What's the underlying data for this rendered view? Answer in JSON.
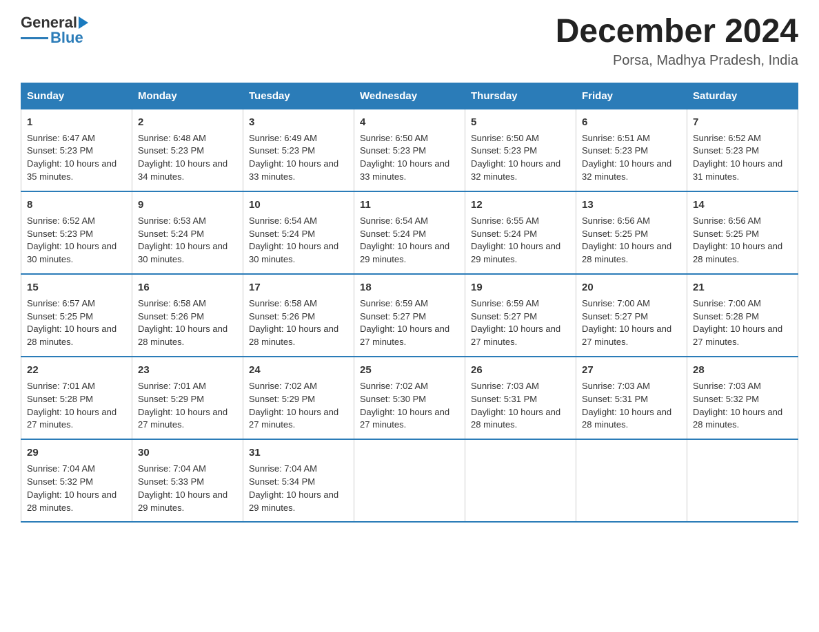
{
  "logo": {
    "text_general": "General",
    "text_blue": "Blue"
  },
  "title": "December 2024",
  "location": "Porsa, Madhya Pradesh, India",
  "days_of_week": [
    "Sunday",
    "Monday",
    "Tuesday",
    "Wednesday",
    "Thursday",
    "Friday",
    "Saturday"
  ],
  "weeks": [
    [
      {
        "day": "1",
        "sunrise": "6:47 AM",
        "sunset": "5:23 PM",
        "daylight": "10 hours and 35 minutes."
      },
      {
        "day": "2",
        "sunrise": "6:48 AM",
        "sunset": "5:23 PM",
        "daylight": "10 hours and 34 minutes."
      },
      {
        "day": "3",
        "sunrise": "6:49 AM",
        "sunset": "5:23 PM",
        "daylight": "10 hours and 33 minutes."
      },
      {
        "day": "4",
        "sunrise": "6:50 AM",
        "sunset": "5:23 PM",
        "daylight": "10 hours and 33 minutes."
      },
      {
        "day": "5",
        "sunrise": "6:50 AM",
        "sunset": "5:23 PM",
        "daylight": "10 hours and 32 minutes."
      },
      {
        "day": "6",
        "sunrise": "6:51 AM",
        "sunset": "5:23 PM",
        "daylight": "10 hours and 32 minutes."
      },
      {
        "day": "7",
        "sunrise": "6:52 AM",
        "sunset": "5:23 PM",
        "daylight": "10 hours and 31 minutes."
      }
    ],
    [
      {
        "day": "8",
        "sunrise": "6:52 AM",
        "sunset": "5:23 PM",
        "daylight": "10 hours and 30 minutes."
      },
      {
        "day": "9",
        "sunrise": "6:53 AM",
        "sunset": "5:24 PM",
        "daylight": "10 hours and 30 minutes."
      },
      {
        "day": "10",
        "sunrise": "6:54 AM",
        "sunset": "5:24 PM",
        "daylight": "10 hours and 30 minutes."
      },
      {
        "day": "11",
        "sunrise": "6:54 AM",
        "sunset": "5:24 PM",
        "daylight": "10 hours and 29 minutes."
      },
      {
        "day": "12",
        "sunrise": "6:55 AM",
        "sunset": "5:24 PM",
        "daylight": "10 hours and 29 minutes."
      },
      {
        "day": "13",
        "sunrise": "6:56 AM",
        "sunset": "5:25 PM",
        "daylight": "10 hours and 28 minutes."
      },
      {
        "day": "14",
        "sunrise": "6:56 AM",
        "sunset": "5:25 PM",
        "daylight": "10 hours and 28 minutes."
      }
    ],
    [
      {
        "day": "15",
        "sunrise": "6:57 AM",
        "sunset": "5:25 PM",
        "daylight": "10 hours and 28 minutes."
      },
      {
        "day": "16",
        "sunrise": "6:58 AM",
        "sunset": "5:26 PM",
        "daylight": "10 hours and 28 minutes."
      },
      {
        "day": "17",
        "sunrise": "6:58 AM",
        "sunset": "5:26 PM",
        "daylight": "10 hours and 28 minutes."
      },
      {
        "day": "18",
        "sunrise": "6:59 AM",
        "sunset": "5:27 PM",
        "daylight": "10 hours and 27 minutes."
      },
      {
        "day": "19",
        "sunrise": "6:59 AM",
        "sunset": "5:27 PM",
        "daylight": "10 hours and 27 minutes."
      },
      {
        "day": "20",
        "sunrise": "7:00 AM",
        "sunset": "5:27 PM",
        "daylight": "10 hours and 27 minutes."
      },
      {
        "day": "21",
        "sunrise": "7:00 AM",
        "sunset": "5:28 PM",
        "daylight": "10 hours and 27 minutes."
      }
    ],
    [
      {
        "day": "22",
        "sunrise": "7:01 AM",
        "sunset": "5:28 PM",
        "daylight": "10 hours and 27 minutes."
      },
      {
        "day": "23",
        "sunrise": "7:01 AM",
        "sunset": "5:29 PM",
        "daylight": "10 hours and 27 minutes."
      },
      {
        "day": "24",
        "sunrise": "7:02 AM",
        "sunset": "5:29 PM",
        "daylight": "10 hours and 27 minutes."
      },
      {
        "day": "25",
        "sunrise": "7:02 AM",
        "sunset": "5:30 PM",
        "daylight": "10 hours and 27 minutes."
      },
      {
        "day": "26",
        "sunrise": "7:03 AM",
        "sunset": "5:31 PM",
        "daylight": "10 hours and 28 minutes."
      },
      {
        "day": "27",
        "sunrise": "7:03 AM",
        "sunset": "5:31 PM",
        "daylight": "10 hours and 28 minutes."
      },
      {
        "day": "28",
        "sunrise": "7:03 AM",
        "sunset": "5:32 PM",
        "daylight": "10 hours and 28 minutes."
      }
    ],
    [
      {
        "day": "29",
        "sunrise": "7:04 AM",
        "sunset": "5:32 PM",
        "daylight": "10 hours and 28 minutes."
      },
      {
        "day": "30",
        "sunrise": "7:04 AM",
        "sunset": "5:33 PM",
        "daylight": "10 hours and 29 minutes."
      },
      {
        "day": "31",
        "sunrise": "7:04 AM",
        "sunset": "5:34 PM",
        "daylight": "10 hours and 29 minutes."
      },
      null,
      null,
      null,
      null
    ]
  ]
}
